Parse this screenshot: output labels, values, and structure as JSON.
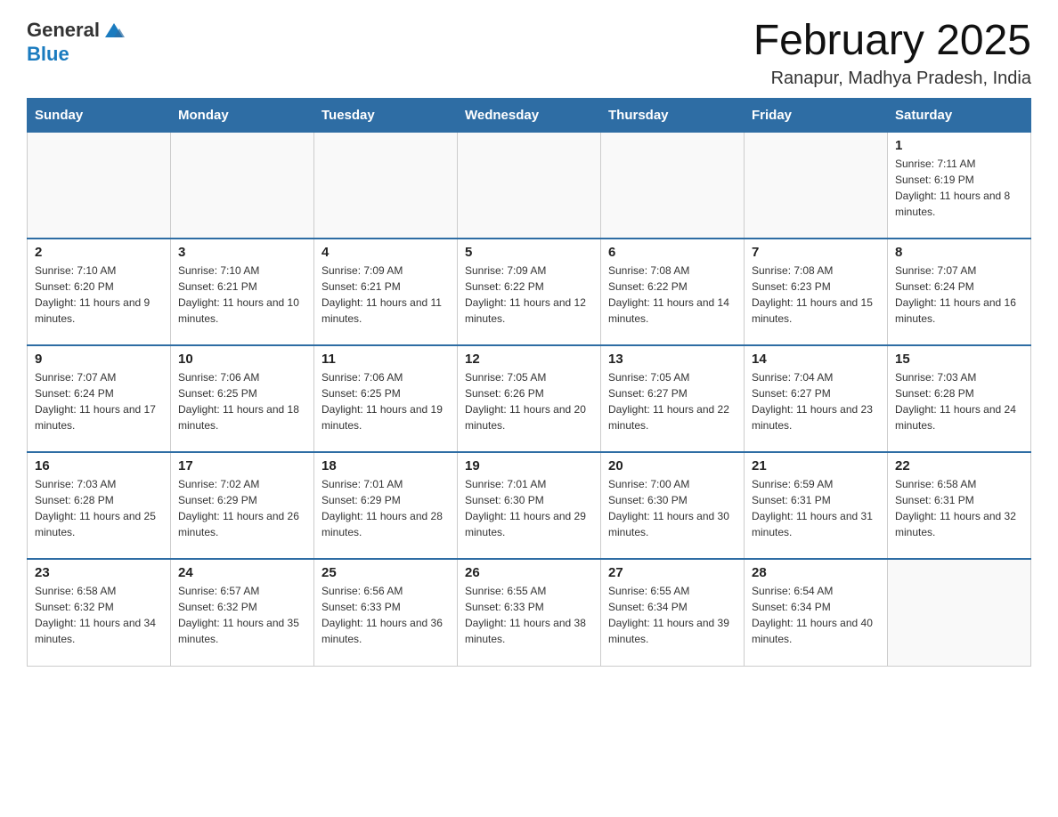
{
  "header": {
    "logo_general": "General",
    "logo_blue": "Blue",
    "month_title": "February 2025",
    "location": "Ranapur, Madhya Pradesh, India"
  },
  "days_of_week": [
    "Sunday",
    "Monday",
    "Tuesday",
    "Wednesday",
    "Thursday",
    "Friday",
    "Saturday"
  ],
  "weeks": [
    [
      {
        "day": "",
        "info": ""
      },
      {
        "day": "",
        "info": ""
      },
      {
        "day": "",
        "info": ""
      },
      {
        "day": "",
        "info": ""
      },
      {
        "day": "",
        "info": ""
      },
      {
        "day": "",
        "info": ""
      },
      {
        "day": "1",
        "info": "Sunrise: 7:11 AM\nSunset: 6:19 PM\nDaylight: 11 hours and 8 minutes."
      }
    ],
    [
      {
        "day": "2",
        "info": "Sunrise: 7:10 AM\nSunset: 6:20 PM\nDaylight: 11 hours and 9 minutes."
      },
      {
        "day": "3",
        "info": "Sunrise: 7:10 AM\nSunset: 6:21 PM\nDaylight: 11 hours and 10 minutes."
      },
      {
        "day": "4",
        "info": "Sunrise: 7:09 AM\nSunset: 6:21 PM\nDaylight: 11 hours and 11 minutes."
      },
      {
        "day": "5",
        "info": "Sunrise: 7:09 AM\nSunset: 6:22 PM\nDaylight: 11 hours and 12 minutes."
      },
      {
        "day": "6",
        "info": "Sunrise: 7:08 AM\nSunset: 6:22 PM\nDaylight: 11 hours and 14 minutes."
      },
      {
        "day": "7",
        "info": "Sunrise: 7:08 AM\nSunset: 6:23 PM\nDaylight: 11 hours and 15 minutes."
      },
      {
        "day": "8",
        "info": "Sunrise: 7:07 AM\nSunset: 6:24 PM\nDaylight: 11 hours and 16 minutes."
      }
    ],
    [
      {
        "day": "9",
        "info": "Sunrise: 7:07 AM\nSunset: 6:24 PM\nDaylight: 11 hours and 17 minutes."
      },
      {
        "day": "10",
        "info": "Sunrise: 7:06 AM\nSunset: 6:25 PM\nDaylight: 11 hours and 18 minutes."
      },
      {
        "day": "11",
        "info": "Sunrise: 7:06 AM\nSunset: 6:25 PM\nDaylight: 11 hours and 19 minutes."
      },
      {
        "day": "12",
        "info": "Sunrise: 7:05 AM\nSunset: 6:26 PM\nDaylight: 11 hours and 20 minutes."
      },
      {
        "day": "13",
        "info": "Sunrise: 7:05 AM\nSunset: 6:27 PM\nDaylight: 11 hours and 22 minutes."
      },
      {
        "day": "14",
        "info": "Sunrise: 7:04 AM\nSunset: 6:27 PM\nDaylight: 11 hours and 23 minutes."
      },
      {
        "day": "15",
        "info": "Sunrise: 7:03 AM\nSunset: 6:28 PM\nDaylight: 11 hours and 24 minutes."
      }
    ],
    [
      {
        "day": "16",
        "info": "Sunrise: 7:03 AM\nSunset: 6:28 PM\nDaylight: 11 hours and 25 minutes."
      },
      {
        "day": "17",
        "info": "Sunrise: 7:02 AM\nSunset: 6:29 PM\nDaylight: 11 hours and 26 minutes."
      },
      {
        "day": "18",
        "info": "Sunrise: 7:01 AM\nSunset: 6:29 PM\nDaylight: 11 hours and 28 minutes."
      },
      {
        "day": "19",
        "info": "Sunrise: 7:01 AM\nSunset: 6:30 PM\nDaylight: 11 hours and 29 minutes."
      },
      {
        "day": "20",
        "info": "Sunrise: 7:00 AM\nSunset: 6:30 PM\nDaylight: 11 hours and 30 minutes."
      },
      {
        "day": "21",
        "info": "Sunrise: 6:59 AM\nSunset: 6:31 PM\nDaylight: 11 hours and 31 minutes."
      },
      {
        "day": "22",
        "info": "Sunrise: 6:58 AM\nSunset: 6:31 PM\nDaylight: 11 hours and 32 minutes."
      }
    ],
    [
      {
        "day": "23",
        "info": "Sunrise: 6:58 AM\nSunset: 6:32 PM\nDaylight: 11 hours and 34 minutes."
      },
      {
        "day": "24",
        "info": "Sunrise: 6:57 AM\nSunset: 6:32 PM\nDaylight: 11 hours and 35 minutes."
      },
      {
        "day": "25",
        "info": "Sunrise: 6:56 AM\nSunset: 6:33 PM\nDaylight: 11 hours and 36 minutes."
      },
      {
        "day": "26",
        "info": "Sunrise: 6:55 AM\nSunset: 6:33 PM\nDaylight: 11 hours and 38 minutes."
      },
      {
        "day": "27",
        "info": "Sunrise: 6:55 AM\nSunset: 6:34 PM\nDaylight: 11 hours and 39 minutes."
      },
      {
        "day": "28",
        "info": "Sunrise: 6:54 AM\nSunset: 6:34 PM\nDaylight: 11 hours and 40 minutes."
      },
      {
        "day": "",
        "info": ""
      }
    ]
  ]
}
